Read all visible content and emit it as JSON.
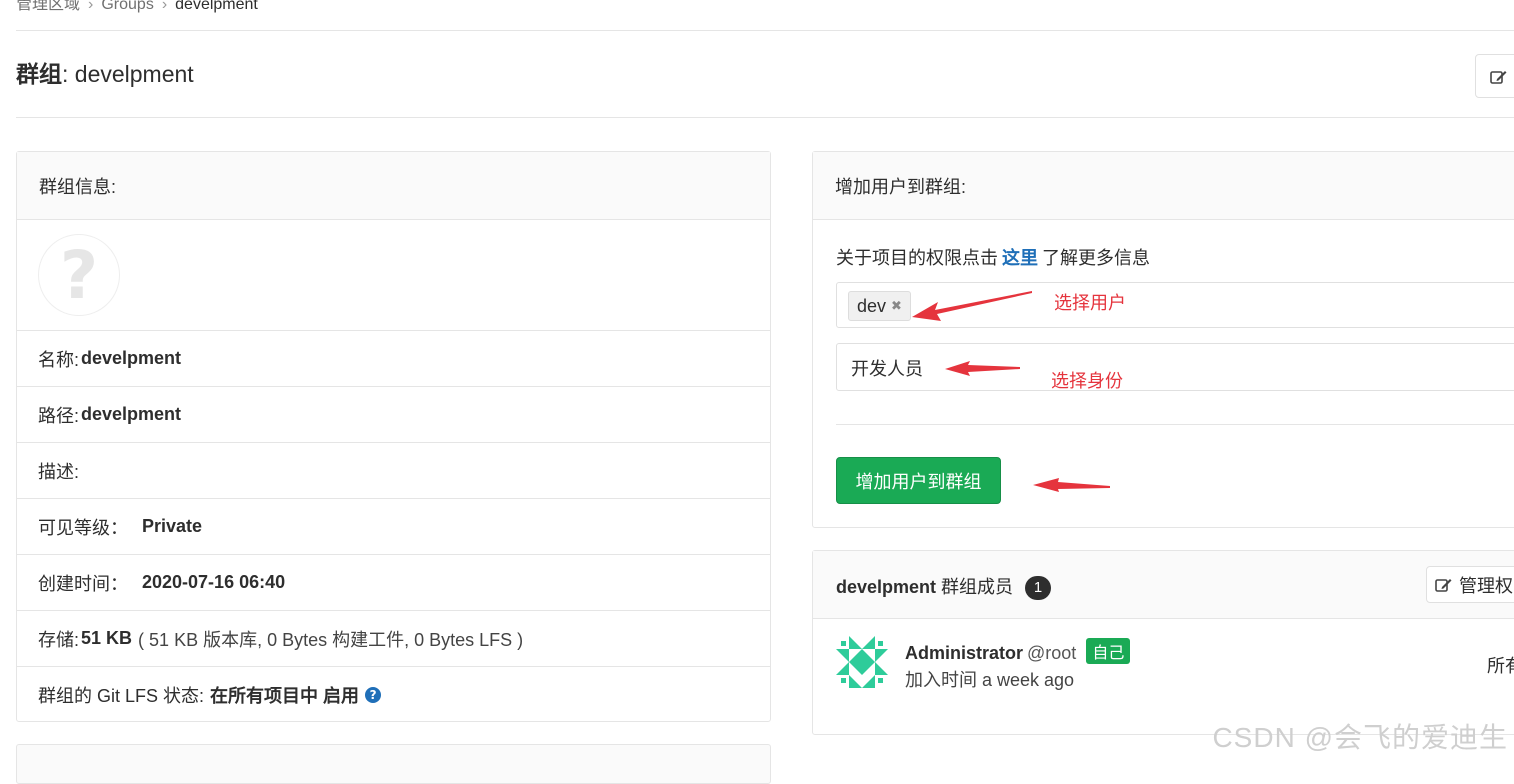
{
  "breadcrumb": {
    "admin": "管理区域",
    "groups": "Groups",
    "current": "develpment"
  },
  "page": {
    "title_prefix": "群组",
    "title_name": ": develpment"
  },
  "group_info": {
    "header": "群组信息:",
    "rows": [
      {
        "label": "名称:",
        "value": "develpment"
      },
      {
        "label": "路径:",
        "value": "develpment"
      },
      {
        "label": "描述:",
        "value": ""
      },
      {
        "label": "可见等级：",
        "value": "Private"
      },
      {
        "label": "创建时间：",
        "value": "2020-07-16 06:40"
      }
    ],
    "storage": {
      "label": "存储:",
      "value": "51 KB",
      "detail": "( 51 KB 版本库, 0 Bytes 构建工件, 0 Bytes LFS )"
    },
    "lfs": {
      "label": "群组的 Git LFS 状态:",
      "value": "在所有项目中 启用"
    }
  },
  "add_user": {
    "header": "增加用户到群组:",
    "permission_prefix": "关于项目的权限点击",
    "permission_link": "这里",
    "permission_suffix": "了解更多信息",
    "selected_user_token": "dev",
    "role_value": "开发人员",
    "submit_label": "增加用户到群组"
  },
  "members": {
    "group_name": "develpment",
    "title_suffix": " 群组成员",
    "count": "1",
    "manage_label": "管理权",
    "list": [
      {
        "name": "Administrator",
        "handle": "@root",
        "badge": "自己",
        "joined": "加入时间 a week ago",
        "role": "所有"
      }
    ]
  },
  "annotations": {
    "select_user": "选择用户",
    "select_role": "选择身份"
  },
  "watermark": "CSDN @会飞的爱迪生",
  "colors": {
    "primary_green": "#1aaa55",
    "link_blue": "#1f6fb8",
    "annotation_red": "#e5343d",
    "avatar_teal": "#2ecc9a"
  }
}
